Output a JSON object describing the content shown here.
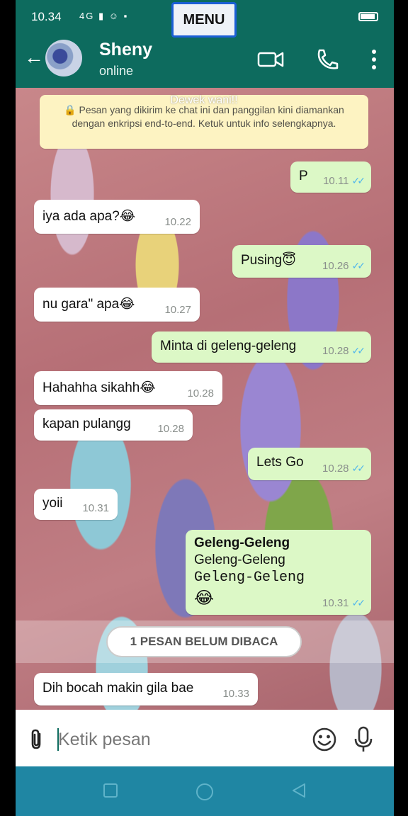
{
  "statusbar": {
    "time": "10.34",
    "indicators": "4G ▮ ☺ ▪",
    "battery": "battery-icon"
  },
  "menu": {
    "label": "MENU"
  },
  "header": {
    "name": "Sheny",
    "status": "online"
  },
  "encryption": {
    "overlay_text": "Dewek wani!!",
    "notice": "🔒 Pesan yang dikirim ke chat ini dan panggilan kini diamankan dengan enkripsi end-to-end. Ketuk untuk info selengkapnya."
  },
  "messages": [
    {
      "dir": "out",
      "text": "P",
      "time": "10.11"
    },
    {
      "dir": "in",
      "text": "iya ada apa?😂",
      "time": "10.22"
    },
    {
      "dir": "out",
      "text": "Pusing😇",
      "time": "10.26"
    },
    {
      "dir": "in",
      "text": "nu gara\" apa😂",
      "time": "10.27"
    },
    {
      "dir": "out",
      "text": "Minta di geleng-geleng",
      "time": "10.28"
    },
    {
      "dir": "in",
      "text": "Hahahha sikahh😂",
      "time": "10.28"
    },
    {
      "dir": "in",
      "text": "kapan pulangg",
      "time": "10.28"
    },
    {
      "dir": "out",
      "text": "Lets Go",
      "time": "10.28"
    },
    {
      "dir": "in",
      "text": "yoii",
      "time": "10.31"
    },
    {
      "dir": "out",
      "line1": "Geleng-Geleng",
      "line2": "Geleng-Geleng",
      "line3": "Geleng-Geleng",
      "line4": "😂",
      "time": "10.31"
    },
    {
      "dir": "in",
      "text": "Dih bocah makin gila bae",
      "time": "10.33"
    }
  ],
  "unread": {
    "label": "1 PESAN BELUM DIBACA"
  },
  "input": {
    "placeholder": "Ketik pesan"
  },
  "ticks": "✓✓",
  "colors": {
    "header": "#0d6b5e",
    "outgoing": "#dcf8c6",
    "incoming": "#ffffff",
    "navbar": "#1f86a3"
  }
}
